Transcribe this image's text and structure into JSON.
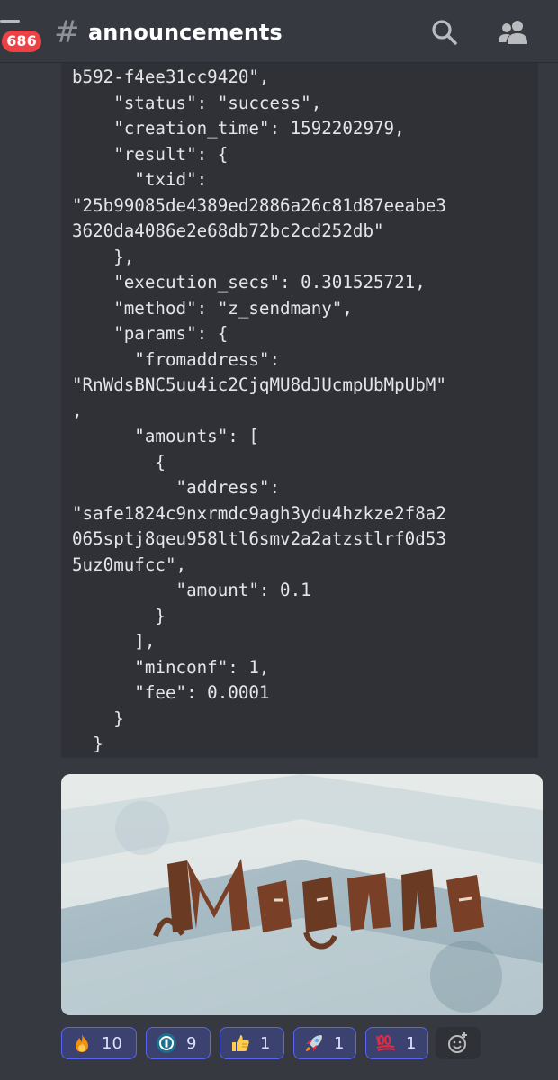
{
  "header": {
    "badge_count": "686",
    "hash_symbol": "#",
    "channel_name": "announcements",
    "search_icon": "search-icon",
    "members_icon": "members-icon"
  },
  "message": {
    "code_text": "b592-f4ee31cc9420\",\n    \"status\": \"success\",\n    \"creation_time\": 1592202979,\n    \"result\": {\n      \"txid\":\n\"25b99085de4389ed2886a26c81d87eeabe3\n3620da4086e2e68db72bc2cd252db\"\n    },\n    \"execution_secs\": 0.301525721,\n    \"method\": \"z_sendmany\",\n    \"params\": {\n      \"fromaddress\":\n\"RnWdsBNC5uu4ic2CjqMU8dJUcmpUbMpUbM\"\n,\n      \"amounts\": [\n        {\n          \"address\":\n\"safe1824c9nxrmdc9agh3ydu4hzkze2f8a2\n065sptj8qeu958ltl6smv2a2atzstlrf0d53\n5uz0mufcc\",\n          \"amount\": 0.1\n        }\n      ],\n      \"minconf\": 1,\n      \"fee\": 0.0001\n    }\n  }",
    "embed_image_text": "Magna"
  },
  "reactions": [
    {
      "emoji": "fire-emoji",
      "count": "10"
    },
    {
      "emoji": "token-logo-emoji",
      "count": "9"
    },
    {
      "emoji": "thumbs-up-emoji",
      "count": "1"
    },
    {
      "emoji": "rocket-emoji",
      "count": "1"
    },
    {
      "emoji": "hundred-points-emoji",
      "count": "1"
    }
  ],
  "add_reaction_icon": "add-reaction-icon",
  "colors": {
    "background": "#36393f",
    "code_background": "#2f3136",
    "badge": "#ed4245",
    "reaction_bg": "#3b4270",
    "reaction_border": "#5865f2"
  }
}
